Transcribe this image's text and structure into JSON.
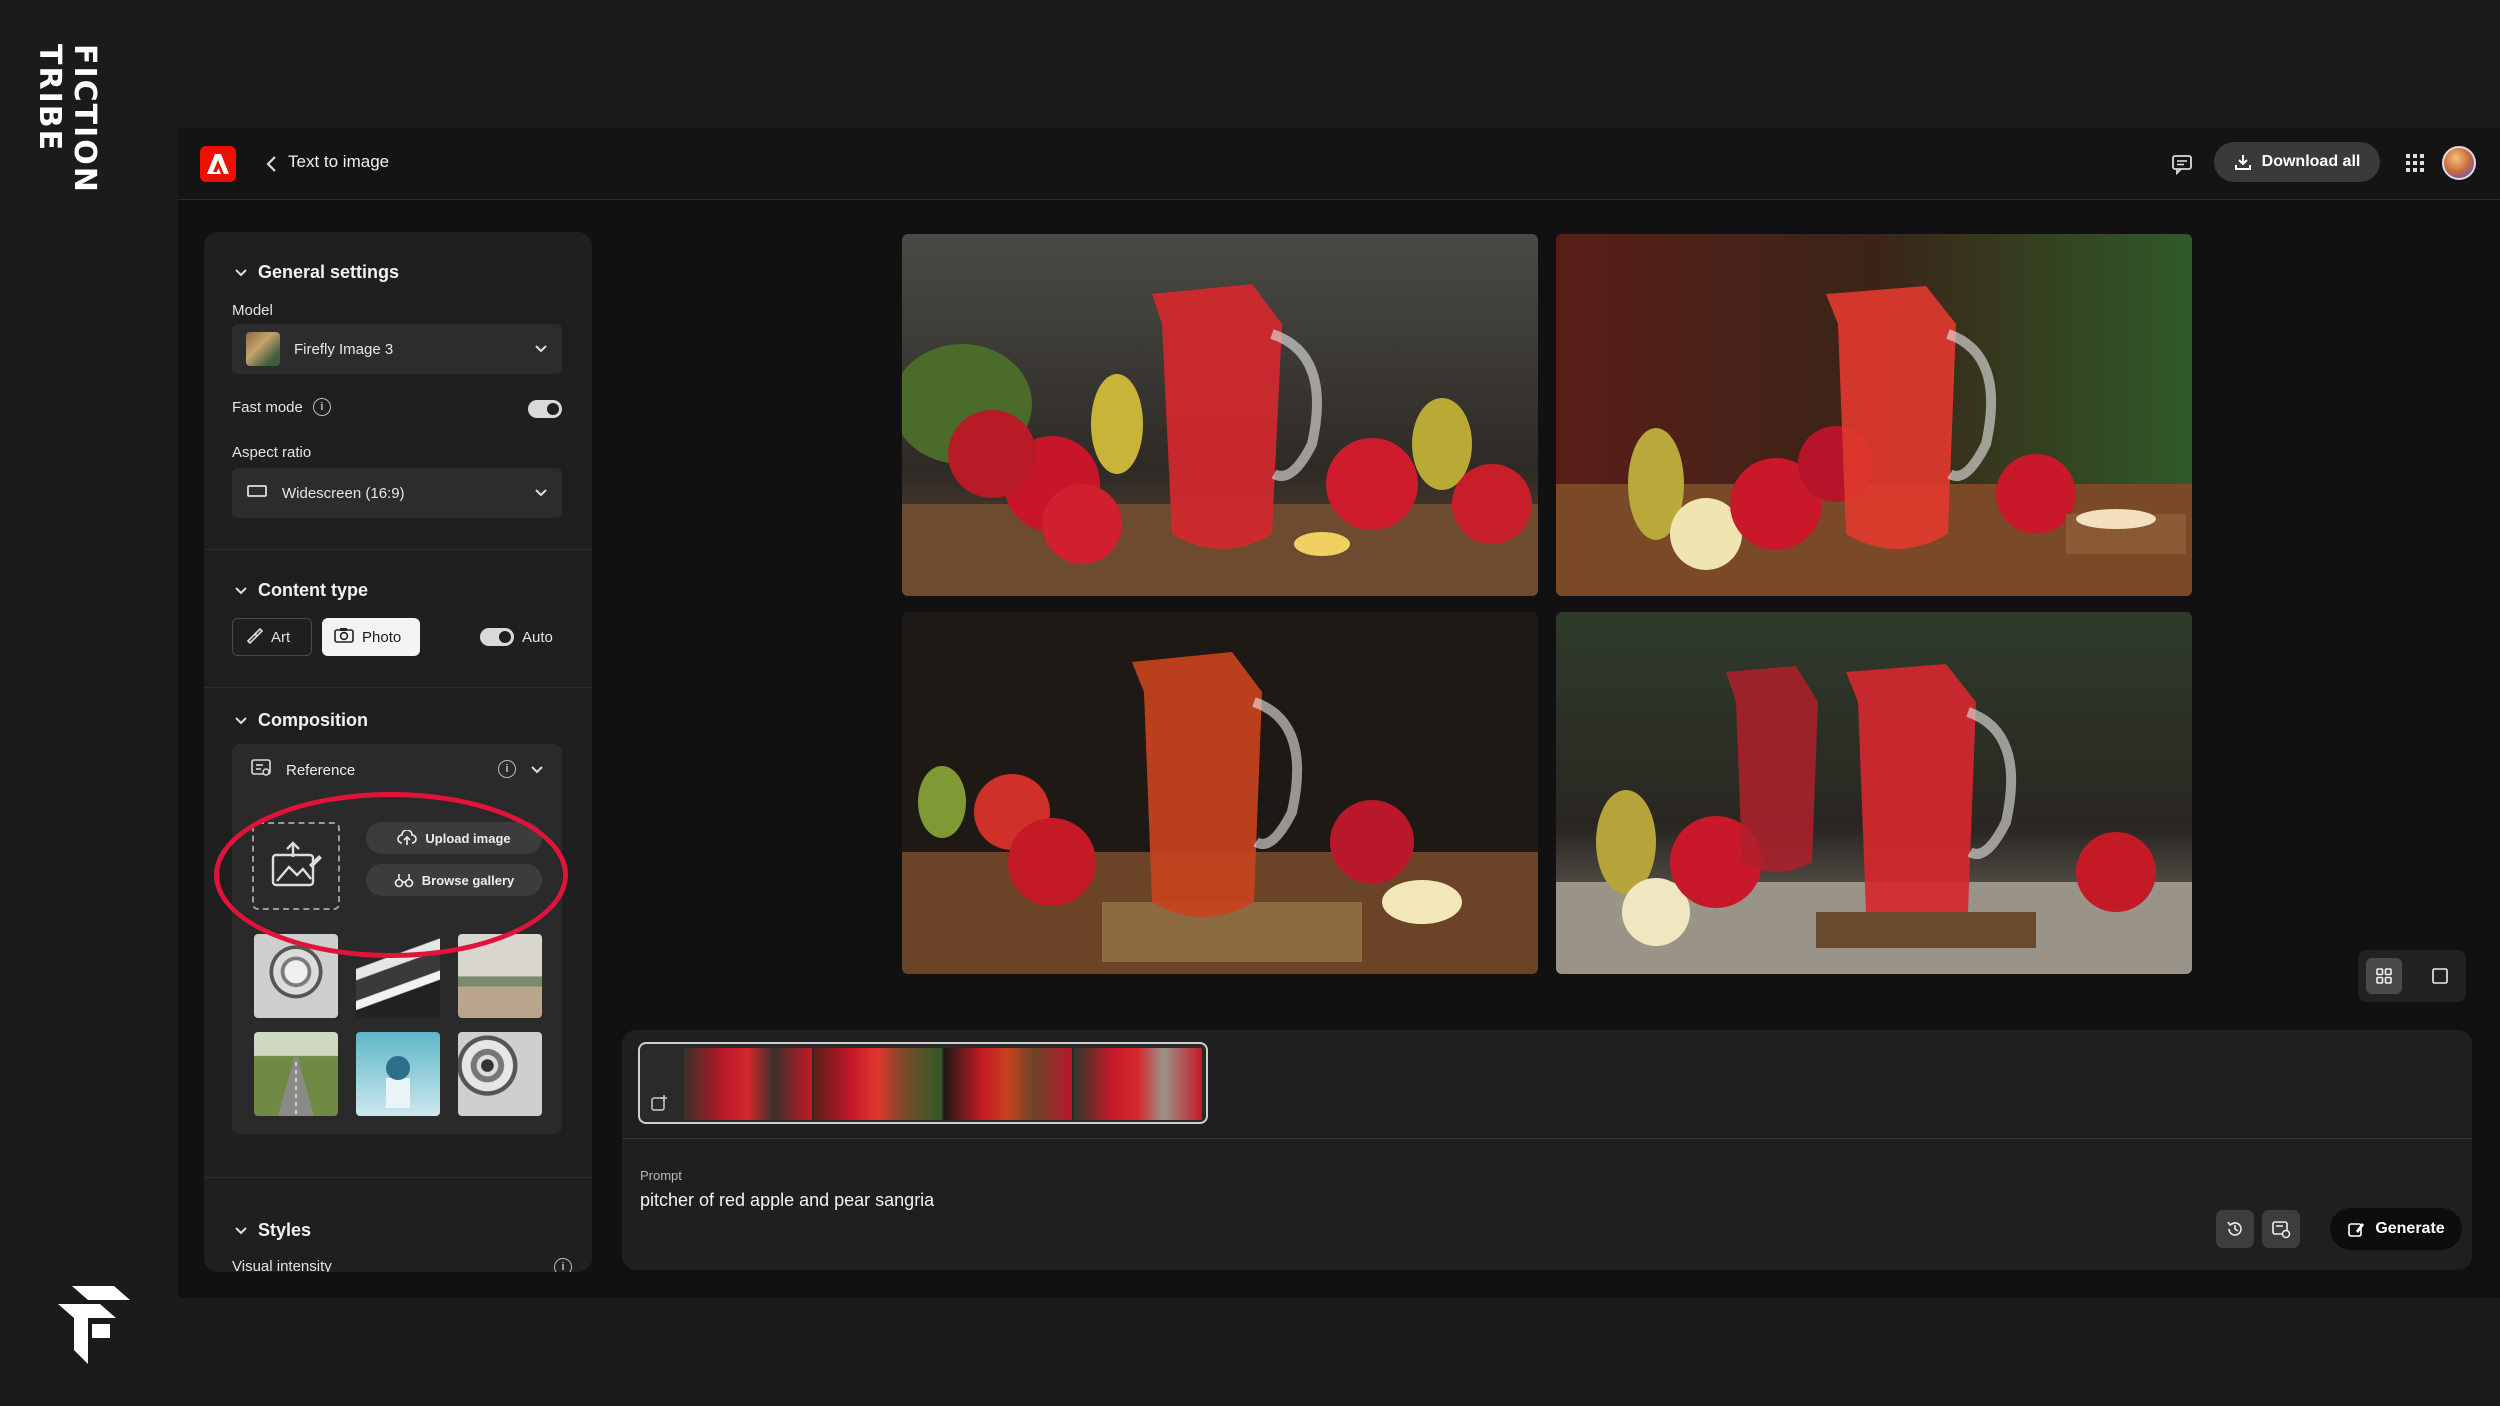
{
  "branding": {
    "vertical_text": "FICTION TRIBE"
  },
  "header": {
    "back_label": "Text to image",
    "download_all_label": "Download all"
  },
  "general_settings": {
    "title": "General settings",
    "model_label": "Model",
    "model_value": "Firefly Image 3",
    "fast_mode_label": "Fast mode",
    "fast_mode_on": true,
    "aspect_ratio_label": "Aspect ratio",
    "aspect_ratio_value": "Widescreen (16:9)"
  },
  "content_type": {
    "title": "Content type",
    "art_label": "Art",
    "photo_label": "Photo",
    "selected": "Photo",
    "auto_label": "Auto",
    "auto_on": true
  },
  "composition": {
    "title": "Composition",
    "reference_label": "Reference",
    "upload_label": "Upload image",
    "browse_label": "Browse gallery"
  },
  "styles": {
    "title": "Styles",
    "visual_intensity_label": "Visual intensity"
  },
  "prompt": {
    "label": "Prompt",
    "text": "pitcher of red apple and pear sangria",
    "generate_label": "Generate"
  },
  "colors": {
    "accent_red": "#eb1000",
    "highlight_ring": "#e0133a",
    "panel_bg": "#1f1f1f"
  }
}
